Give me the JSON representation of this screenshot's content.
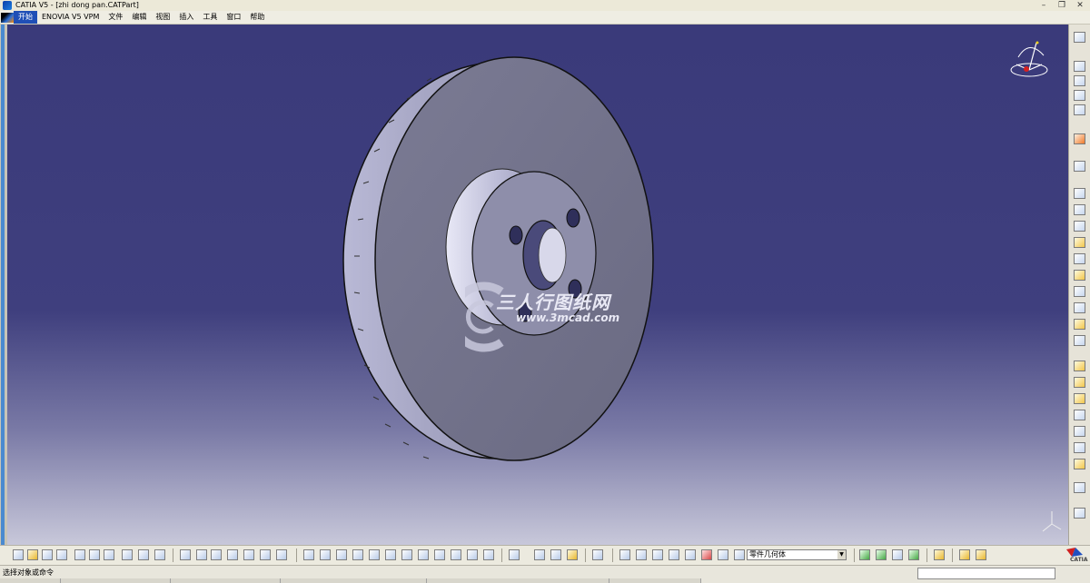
{
  "window": {
    "title": "CATIA V5 - [zhi dong pan.CATPart]"
  },
  "menubar": {
    "items": [
      "开始",
      "ENOVIA V5 VPM",
      "文件",
      "编辑",
      "视图",
      "插入",
      "工具",
      "窗口",
      "帮助"
    ]
  },
  "toolbar": {
    "geometry_set_value": "零件几何体"
  },
  "watermark": {
    "cn_text": "三人行图纸网",
    "url_text": "www.3mcad.com"
  },
  "logo": {
    "text": "CATIA"
  },
  "statusbar": {
    "message": "选择对象或命令"
  },
  "icons": [
    "compass-icon",
    "axis-icon",
    "catia-logo-icon",
    "new-icon",
    "open-icon",
    "save-icon",
    "print-icon",
    "cut-icon",
    "copy-icon",
    "paste-icon",
    "undo-icon",
    "redo-icon",
    "formula-icon",
    "zoom-in-icon",
    "zoom-out-icon",
    "rotate-icon",
    "pan-icon"
  ],
  "colors": {
    "viewport_top": "#3a3a7a",
    "viewport_bottom": "#c8c8da",
    "part": "#777790",
    "highlight": "#1f4fb6"
  }
}
